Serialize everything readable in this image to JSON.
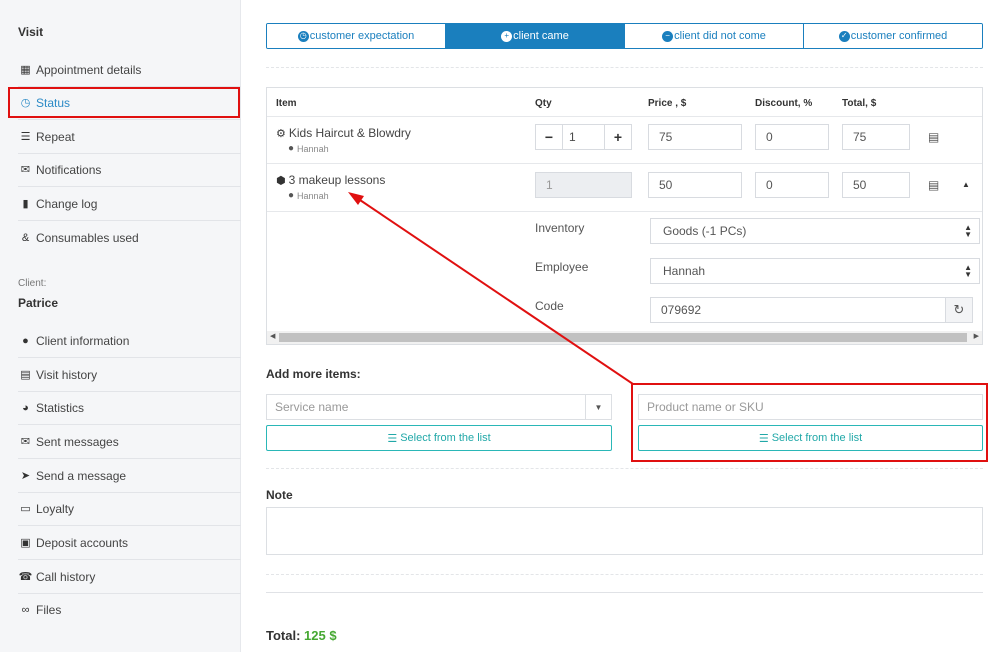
{
  "sidebar": {
    "visit_heading": "Visit",
    "visit_items": [
      {
        "label": "Appointment details",
        "icon": "calendar-icon"
      },
      {
        "label": "Status",
        "icon": "clock-icon"
      },
      {
        "label": "Repeat",
        "icon": "list-icon"
      },
      {
        "label": "Notifications",
        "icon": "comments-icon"
      },
      {
        "label": "Change log",
        "icon": "document-icon"
      },
      {
        "label": "Consumables used",
        "icon": "ampersand-icon"
      }
    ],
    "client_caption": "Client:",
    "client_name": "Patrice",
    "client_items": [
      {
        "label": "Client information",
        "icon": "user-icon"
      },
      {
        "label": "Visit history",
        "icon": "history-icon"
      },
      {
        "label": "Statistics",
        "icon": "pie-chart-icon"
      },
      {
        "label": "Sent messages",
        "icon": "envelope-icon"
      },
      {
        "label": "Send a message",
        "icon": "paper-plane-icon"
      },
      {
        "label": "Loyalty",
        "icon": "credit-card-icon"
      },
      {
        "label": "Deposit accounts",
        "icon": "briefcase-icon"
      },
      {
        "label": "Call history",
        "icon": "phone-icon"
      },
      {
        "label": "Files",
        "icon": "paperclip-icon"
      }
    ]
  },
  "status_tabs": [
    {
      "label": "customer expectation",
      "icon": "clock-icon",
      "active": false
    },
    {
      "label": "client came",
      "icon": "plus-circle-icon",
      "active": true
    },
    {
      "label": "client did not come",
      "icon": "minus-circle-icon",
      "active": false
    },
    {
      "label": "customer confirmed",
      "icon": "check-circle-icon",
      "active": false
    }
  ],
  "table": {
    "headers": {
      "item": "Item",
      "qty": "Qty",
      "price": "Price , $",
      "discount": "Discount, %",
      "total": "Total, $"
    },
    "rows": [
      {
        "name": "Kids Haircut & Blowdry",
        "icon": "gear-icon",
        "employee": "Hannah",
        "qty": "1",
        "price": "75",
        "discount": "0",
        "total": "75"
      },
      {
        "name": "3 makeup lessons",
        "icon": "box-icon",
        "employee": "Hannah",
        "qty": "1",
        "price": "50",
        "discount": "0",
        "total": "50"
      }
    ],
    "details": {
      "inventory_label": "Inventory",
      "inventory_value": "Goods (-1 PCs)",
      "employee_label": "Employee",
      "employee_value": "Hannah",
      "code_label": "Code",
      "code_value": "079692"
    }
  },
  "add_items": {
    "title": "Add more items:",
    "service_placeholder": "Service name",
    "product_placeholder": "Product name or SKU",
    "select_label": "Select from the list"
  },
  "note": {
    "title": "Note",
    "value": ""
  },
  "total": {
    "label": "Total:",
    "amount": "125 $"
  },
  "colors": {
    "accent": "#1a7fbe",
    "teal": "#2ab7b7",
    "annotation": "#e01010",
    "total_green": "#46a832"
  }
}
